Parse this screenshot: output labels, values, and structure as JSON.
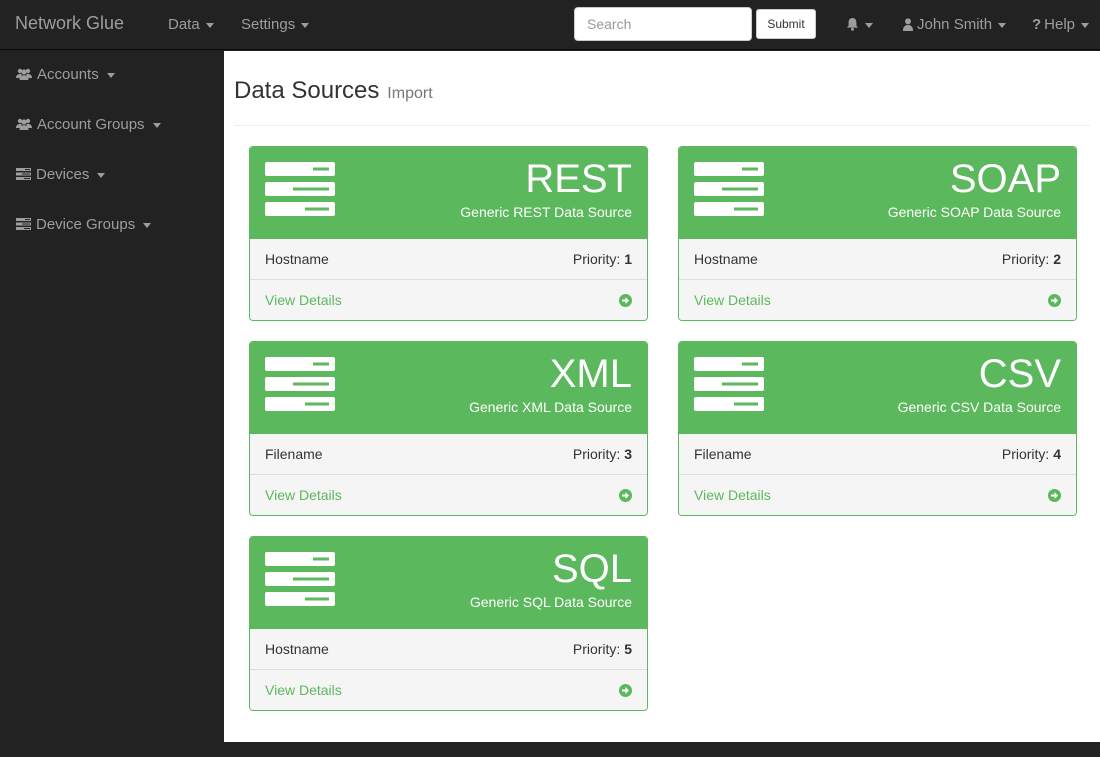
{
  "navbar": {
    "brand": "Network Glue",
    "menu": [
      {
        "label": "Data"
      },
      {
        "label": "Settings"
      }
    ],
    "search": {
      "placeholder": "Search",
      "value": ""
    },
    "submit_label": "Submit",
    "user_label": "John Smith",
    "help_label": "Help"
  },
  "sidebar": {
    "items": [
      {
        "label": "Accounts",
        "icon": "users-icon"
      },
      {
        "label": "Account Groups",
        "icon": "users-icon"
      },
      {
        "label": "Devices",
        "icon": "server-icon"
      },
      {
        "label": "Device Groups",
        "icon": "server-icon"
      }
    ]
  },
  "main": {
    "title": "Data Sources",
    "subtitle": "Import",
    "panels": [
      {
        "name": "REST",
        "description": "Generic REST Data Source",
        "field": "Hostname",
        "priority_label": "Priority:",
        "priority": "1",
        "link": "View Details"
      },
      {
        "name": "SOAP",
        "description": "Generic SOAP Data Source",
        "field": "Hostname",
        "priority_label": "Priority:",
        "priority": "2",
        "link": "View Details"
      },
      {
        "name": "XML",
        "description": "Generic XML Data Source",
        "field": "Filename",
        "priority_label": "Priority:",
        "priority": "3",
        "link": "View Details"
      },
      {
        "name": "CSV",
        "description": "Generic CSV Data Source",
        "field": "Filename",
        "priority_label": "Priority:",
        "priority": "4",
        "link": "View Details"
      },
      {
        "name": "SQL",
        "description": "Generic SQL Data Source",
        "field": "Hostname",
        "priority_label": "Priority:",
        "priority": "5",
        "link": "View Details"
      }
    ]
  },
  "colors": {
    "navbar_bg": "#222222",
    "nav_text": "#9d9d9d",
    "success": "#5cb85c",
    "panel_footer_bg": "#f5f5f5"
  }
}
